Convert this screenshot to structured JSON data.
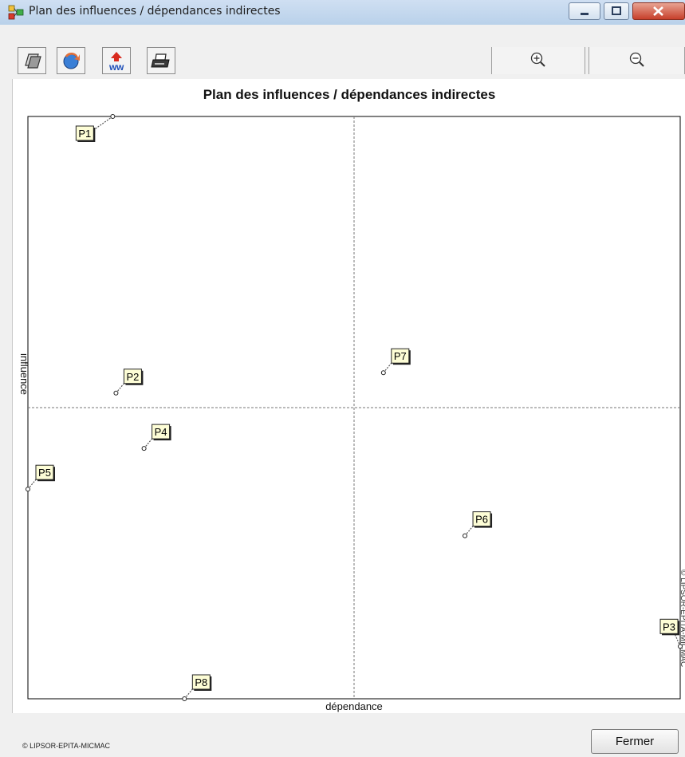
{
  "window": {
    "title": "Plan des influences / dépendances indirectes"
  },
  "toolbar": {
    "buttons": [
      {
        "name": "copy-icon"
      },
      {
        "name": "refresh-icon"
      },
      {
        "name": "export-icon"
      },
      {
        "name": "printer-icon"
      }
    ],
    "zoom_in_icon": "zoom-in-icon",
    "zoom_out_icon": "zoom-out-icon"
  },
  "chart_data": {
    "type": "scatter",
    "title": "Plan des influences / dépendances indirectes",
    "xlabel": "dépendance",
    "ylabel": "influence",
    "xlim": [
      0,
      1
    ],
    "ylim": [
      0,
      1
    ],
    "grid": false,
    "points": [
      {
        "label": "P1",
        "x": 0.13,
        "y": 1.0
      },
      {
        "label": "P2",
        "x": 0.135,
        "y": 0.525
      },
      {
        "label": "P3",
        "x": 1.0,
        "y": 0.09
      },
      {
        "label": "P4",
        "x": 0.178,
        "y": 0.43
      },
      {
        "label": "P5",
        "x": 0.0,
        "y": 0.36
      },
      {
        "label": "P6",
        "x": 0.67,
        "y": 0.28
      },
      {
        "label": "P7",
        "x": 0.545,
        "y": 0.56
      },
      {
        "label": "P8",
        "x": 0.24,
        "y": 0.0
      }
    ],
    "reference_lines": {
      "x": 0.5,
      "y": 0.5
    },
    "side_watermark": "© LIPSOR-EPITA-MICMAC"
  },
  "footer": {
    "copyright": "© LIPSOR-EPITA-MICMAC",
    "close_label": "Fermer"
  },
  "colors": {
    "label_fill": "#fdfdd6",
    "axis": "#000000",
    "close_red": "#c7402b"
  }
}
